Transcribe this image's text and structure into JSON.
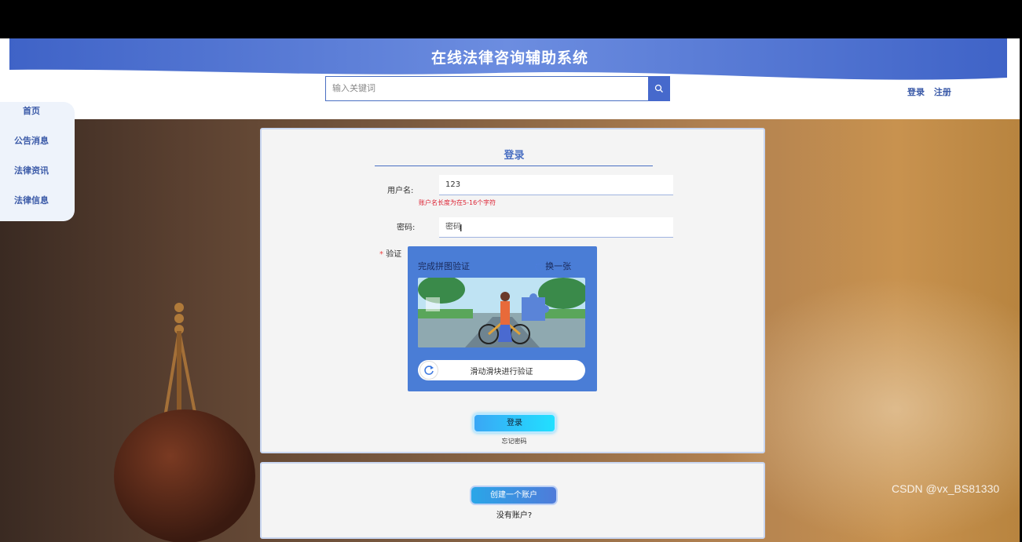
{
  "header": {
    "title": "在线法律咨询辅助系统",
    "search_placeholder": "输入关键词",
    "login_link": "登录",
    "register_link": "注册"
  },
  "sidebar": {
    "items": [
      {
        "label": "首页"
      },
      {
        "label": "公告消息"
      },
      {
        "label": "法律资讯"
      },
      {
        "label": "法律信息"
      }
    ]
  },
  "login": {
    "heading": "登录",
    "username_label": "用户名:",
    "username_value": "123",
    "username_error": "账户名长度为在5-16个字符",
    "password_label": "密码:",
    "password_placeholder": "密码",
    "verify_required_mark": "*",
    "verify_label": "验证",
    "submit_label": "登录",
    "forgot_label": "忘记密码"
  },
  "captcha": {
    "title": "完成拼图验证",
    "refresh_label": "换一张",
    "slider_text": "滑动滑块进行验证"
  },
  "register": {
    "create_label": "创建一个账户",
    "no_account_text": "没有账户?"
  },
  "watermark": "CSDN @vx_BS81330",
  "colors": {
    "accent": "#4a6fc2",
    "captcha_bg": "#4a7dd6",
    "error": "#dd2233"
  }
}
